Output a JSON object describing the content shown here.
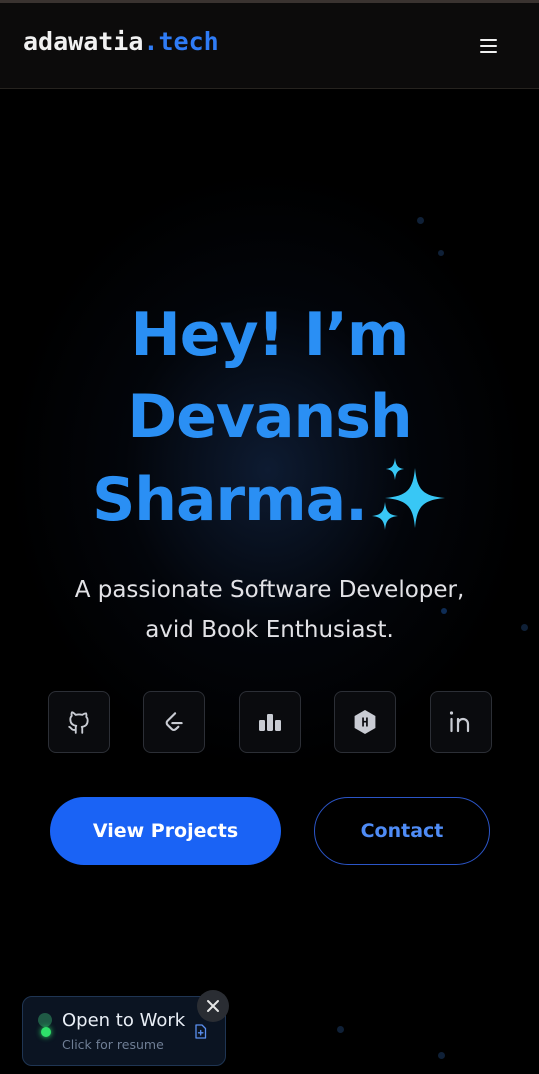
{
  "header": {
    "logo_name": "adawatia",
    "logo_tld": ".tech",
    "menu_icon": "hamburger-menu-icon"
  },
  "hero": {
    "line1": "Hey! I’m",
    "line2": "Devansh",
    "line3": "Sharma.",
    "sparkle_icon": "sparkles-icon",
    "subtitle_line1": "A passionate Software Developer,",
    "subtitle_line2": "avid Book Enthusiast."
  },
  "socials": [
    {
      "name": "github",
      "icon": "github-icon"
    },
    {
      "name": "leetcode",
      "icon": "leetcode-icon"
    },
    {
      "name": "stats",
      "icon": "bar-chart-icon"
    },
    {
      "name": "hackerrank",
      "icon": "hackerrank-icon"
    },
    {
      "name": "linkedin",
      "icon": "linkedin-icon"
    }
  ],
  "actions": {
    "primary_label": "View Projects",
    "secondary_label": "Contact"
  },
  "open_to_work": {
    "title": "Open to Work",
    "subtitle": "Click for resume",
    "close_icon": "close-icon",
    "file_icon": "document-icon"
  },
  "colors": {
    "accent": "#2a8ff4",
    "primary_button": "#1a63f5",
    "logo_tld": "#2f7cf6",
    "status_green": "#2ee06a",
    "background": "#000000"
  }
}
